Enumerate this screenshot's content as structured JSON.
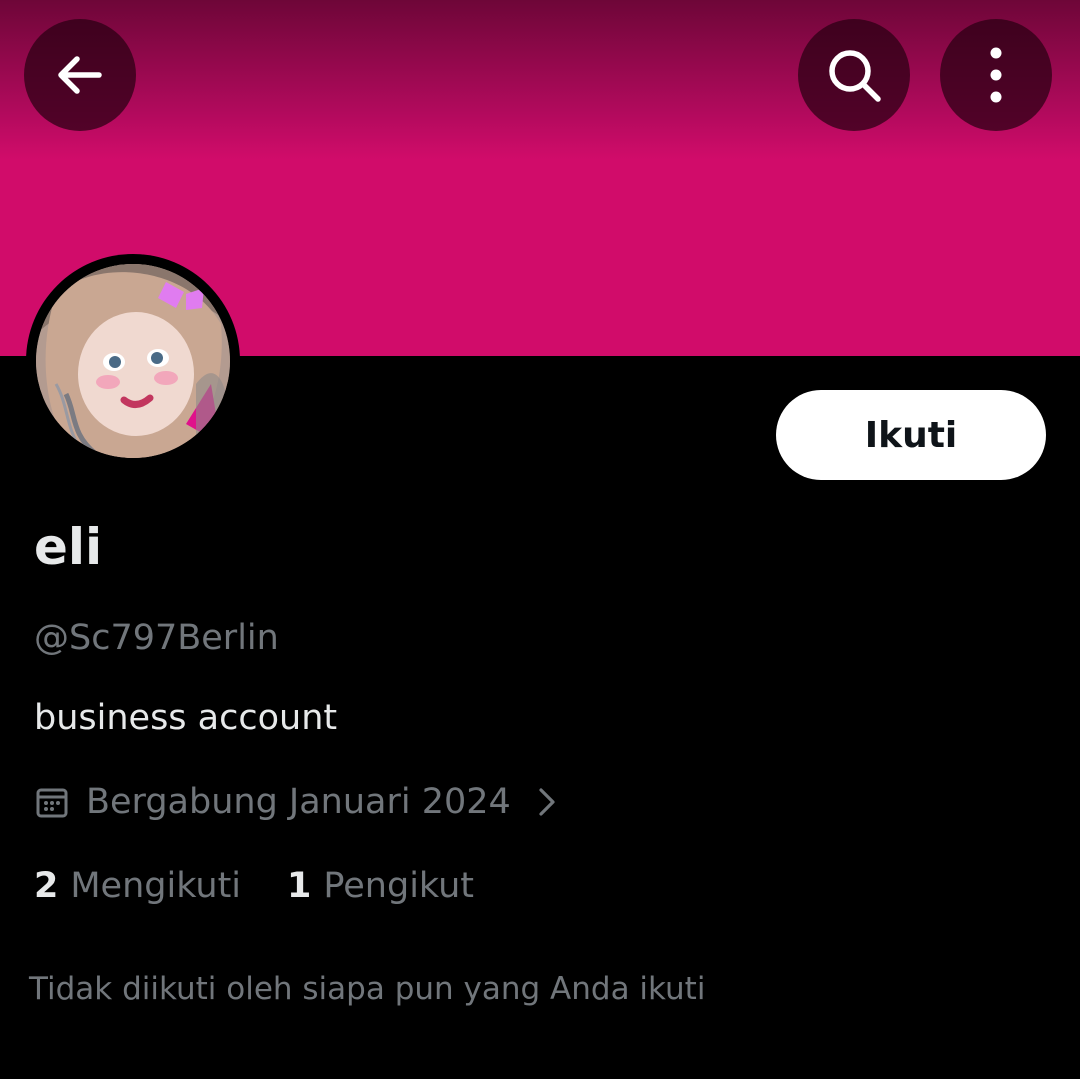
{
  "banner": {
    "color": "#d10c6a"
  },
  "toolbar": {
    "back_icon": "arrow-left-icon",
    "search_icon": "search-icon",
    "more_icon": "more-vertical-icon"
  },
  "profile": {
    "avatar_icon": "avatar-photo",
    "display_name": "eli",
    "handle": "@Sc797Berlin",
    "bio": "business account",
    "joined": "Bergabung Januari 2024",
    "following_count": "2",
    "following_label": "Mengikuti",
    "followers_count": "1",
    "followers_label": "Pengikut",
    "followed_by_note": "Tidak diikuti oleh siapa pun yang Anda ikuti"
  },
  "actions": {
    "follow_label": "Ikuti"
  },
  "colors": {
    "background": "#000000",
    "primary_text": "#e7e9ea",
    "secondary_text": "#71767b",
    "accent_banner": "#d10c6a"
  }
}
